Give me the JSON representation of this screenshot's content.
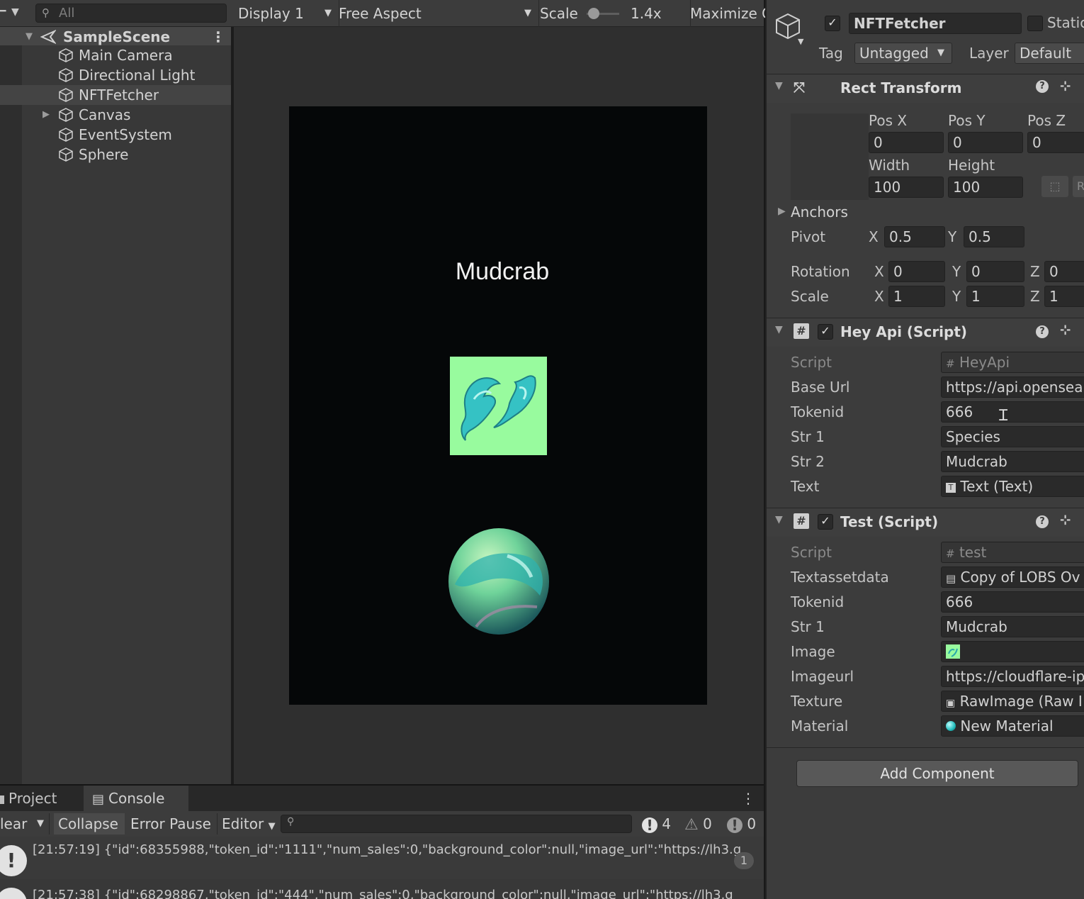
{
  "hierarchy": {
    "search_placeholder": "All",
    "scene_name": "SampleScene",
    "items": [
      {
        "label": "Main Camera"
      },
      {
        "label": "Directional Light"
      },
      {
        "label": "NFTFetcher"
      },
      {
        "label": "Canvas"
      },
      {
        "label": "EventSystem"
      },
      {
        "label": "Sphere"
      }
    ]
  },
  "game_toolbar": {
    "display": "Display 1",
    "aspect": "Free Aspect",
    "scale_label": "Scale",
    "scale_value": "1.4x",
    "maximize": "Maximize C"
  },
  "game_view": {
    "title_text": "Mudcrab"
  },
  "inspector": {
    "object_name": "NFTFetcher",
    "static_label": "Static",
    "tag_label": "Tag",
    "tag_value": "Untagged",
    "layer_label": "Layer",
    "layer_value": "Default",
    "rect_transform": {
      "title": "Rect Transform",
      "pos_x_label": "Pos X",
      "pos_y_label": "Pos Y",
      "pos_z_label": "Pos Z",
      "pos_x": "0",
      "pos_y": "0",
      "pos_z": "0",
      "width_label": "Width",
      "height_label": "Height",
      "width": "100",
      "height": "100",
      "anchors_label": "Anchors",
      "pivot_label": "Pivot",
      "pivot_x": "0.5",
      "pivot_y": "0.5",
      "rotation_label": "Rotation",
      "rot_x": "0",
      "rot_y": "0",
      "rot_z": "0",
      "scale_label": "Scale",
      "scale_x": "1",
      "scale_y": "1",
      "scale_z": "1",
      "x": "X",
      "y": "Y",
      "z": "Z"
    },
    "hey_api": {
      "title": "Hey Api (Script)",
      "rows": [
        {
          "label": "Script",
          "value": "HeyApi"
        },
        {
          "label": "Base Url",
          "value": "https://api.opensea.io"
        },
        {
          "label": "Tokenid",
          "value": "666"
        },
        {
          "label": "Str 1",
          "value": "Species"
        },
        {
          "label": "Str 2",
          "value": "Mudcrab"
        },
        {
          "label": "Text",
          "value": "Text (Text)"
        }
      ]
    },
    "test": {
      "title": "Test (Script)",
      "rows": [
        {
          "label": "Script",
          "value": "test"
        },
        {
          "label": "Textassetdata",
          "value": "Copy of LOBS Ov"
        },
        {
          "label": "Tokenid",
          "value": "666"
        },
        {
          "label": "Str 1",
          "value": "Mudcrab"
        },
        {
          "label": "Image",
          "value": ""
        },
        {
          "label": "Imageurl",
          "value": "https://cloudflare-ipf"
        },
        {
          "label": "Texture",
          "value": "RawImage (Raw I"
        },
        {
          "label": "Material",
          "value": "New Material"
        }
      ]
    },
    "add_component": "Add Component"
  },
  "console": {
    "tab_project": "Project",
    "tab_console": "Console",
    "clear": "lear",
    "collapse": "Collapse",
    "error_pause": "Error Pause",
    "editor": "Editor",
    "count_logs": "4",
    "count_warnings": "0",
    "count_errors": "0",
    "entries": [
      {
        "text": "[21:57:19] {\"id\":68355988,\"token_id\":\"1111\",\"num_sales\":0,\"background_color\":null,\"image_url\":\"https://lh3.g",
        "count": "1"
      },
      {
        "text": "[21:57:38] {\"id\":68298867,\"token_id\":\"444\",\"num_sales\":0,\"background_color\":null,\"image_url\":\"https://lh3.g",
        "count": ""
      }
    ]
  },
  "colors": {
    "accent_green": "#98fb9e",
    "panel": "#3c3c3c",
    "canvas": "#050708"
  }
}
